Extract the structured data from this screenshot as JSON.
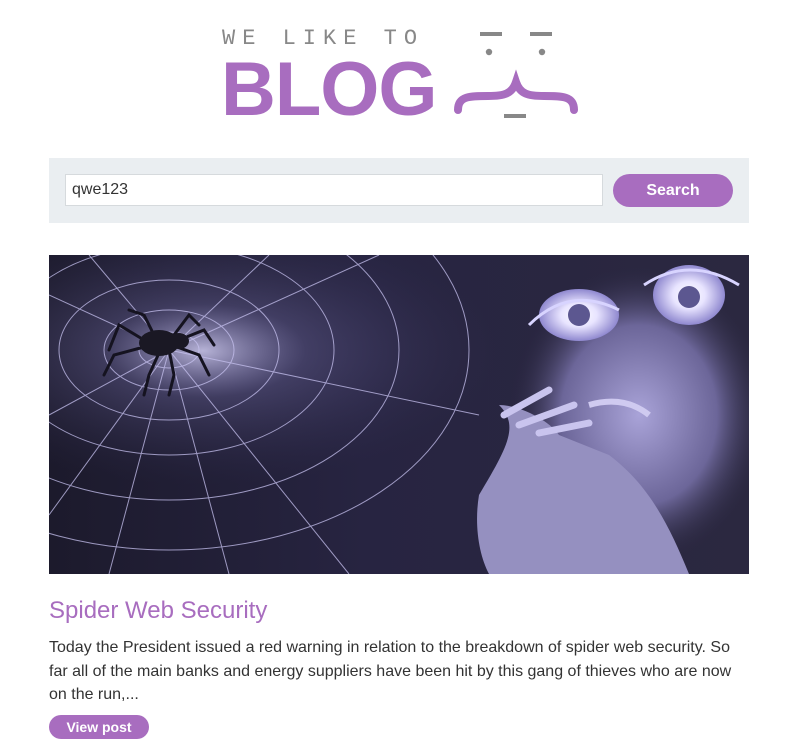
{
  "header": {
    "tagline": "WE LIKE TO",
    "wordmark": "BLOG"
  },
  "search": {
    "value": "qwe123",
    "placeholder": "",
    "button_label": "Search"
  },
  "post": {
    "image_subject": "woman-touching-spider-web-with-spider",
    "title": "Spider Web Security",
    "summary": "Today the President issued a red warning in relation to the breakdown of spider web security. So far all of the main banks and energy suppliers have been hit by this gang of thieves who are now on the run,...",
    "button_label": "View post"
  },
  "colors": {
    "accent": "#a86dbf",
    "search_bg": "#eaeef1",
    "text": "#333333",
    "tagline": "#888888"
  }
}
